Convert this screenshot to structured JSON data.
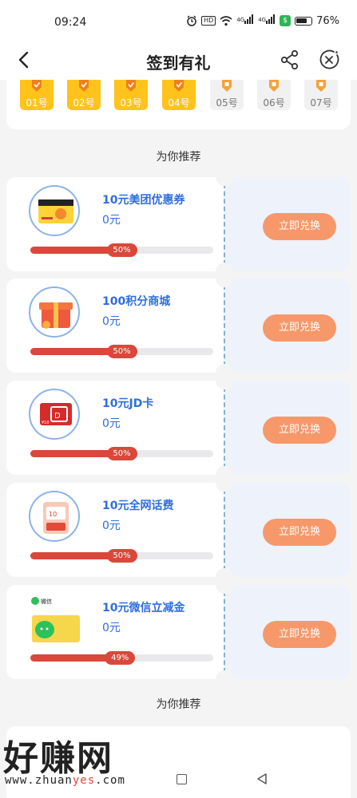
{
  "status_bar": {
    "time": "09:24",
    "hd": "HD",
    "signal1": "4G",
    "signal2": "4G",
    "shield": "$",
    "battery": "76%",
    "icons": [
      "alarm-icon",
      "hd-icon",
      "wifi-icon",
      "signal-icon",
      "signal-icon",
      "security-shield-icon",
      "battery-icon"
    ]
  },
  "nav": {
    "title": "签到有礼",
    "back_icon": "chevron-left-icon",
    "share_icon": "share-icon",
    "close_icon": "close-circle-icon"
  },
  "checkin": {
    "days": [
      {
        "label": "01号",
        "checked": true
      },
      {
        "label": "02号",
        "checked": true
      },
      {
        "label": "03号",
        "checked": true
      },
      {
        "label": "04号",
        "checked": true
      },
      {
        "label": "05号",
        "checked": false
      },
      {
        "label": "06号",
        "checked": false
      },
      {
        "label": "07号",
        "checked": false
      }
    ]
  },
  "recommend_title": "为你推荐",
  "recommend_title_2": "为你推荐",
  "products": [
    {
      "name": "10元美团优惠券",
      "price": "0元",
      "progress_pct": 50,
      "progress_label": "50%",
      "button": "立即兑换",
      "icon": "meituan-voucher-icon"
    },
    {
      "name": "100积分商城",
      "price": "0元",
      "progress_pct": 50,
      "progress_label": "50%",
      "button": "立即兑换",
      "icon": "gift-box-icon"
    },
    {
      "name": "10元JD卡",
      "price": "0元",
      "progress_pct": 50,
      "progress_label": "50%",
      "button": "立即兑换",
      "icon": "jd-card-icon"
    },
    {
      "name": "10元全网话费",
      "price": "0元",
      "progress_pct": 50,
      "progress_label": "50%",
      "button": "立即兑换",
      "icon": "phone-credit-icon"
    },
    {
      "name": "10元微信立减金",
      "price": "0元",
      "progress_pct": 49,
      "progress_label": "49%",
      "button": "立即兑换",
      "icon": "wechat-voucher-icon"
    }
  ],
  "wechat_card_label": "微信",
  "watermark": {
    "main": "好赚网",
    "url_a": "www.zhuan",
    "url_b": "yes",
    "url_c": ".com"
  },
  "colors": {
    "accent_blue": "#2e6ee0",
    "button_orange": "#f7986a",
    "progress_red": "#d9483b",
    "checkin_yellow": "#ffc31c"
  }
}
